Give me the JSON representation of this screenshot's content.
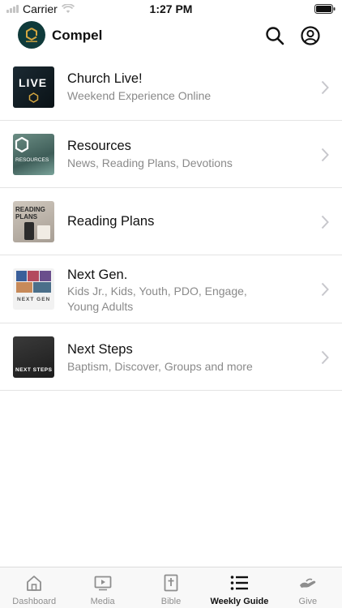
{
  "status": {
    "carrier": "Carrier",
    "time": "1:27 PM"
  },
  "header": {
    "title": "Compel"
  },
  "items": [
    {
      "title": "Church Live!",
      "subtitle": "Weekend Experience Online",
      "thumb_text": "LIVE"
    },
    {
      "title": "Resources",
      "subtitle": "News, Reading Plans, Devotions",
      "thumb_text": "RESOURCES"
    },
    {
      "title": "Reading Plans",
      "subtitle": "",
      "thumb_text": "READING PLANS"
    },
    {
      "title": "Next Gen.",
      "subtitle": "Kids Jr., Kids, Youth, PDO, Engage, Young Adults",
      "thumb_text": "NEXT GEN"
    },
    {
      "title": "Next Steps",
      "subtitle": "Baptism, Discover, Groups and more",
      "thumb_text": "NEXT STEPS"
    }
  ],
  "tabs": [
    {
      "label": "Dashboard",
      "icon": "home-icon"
    },
    {
      "label": "Media",
      "icon": "play-icon"
    },
    {
      "label": "Bible",
      "icon": "bible-icon"
    },
    {
      "label": "Weekly Guide",
      "icon": "list-icon",
      "active": true
    },
    {
      "label": "Give",
      "icon": "give-icon"
    }
  ],
  "colors": {
    "brand": "#0f3a3a",
    "accent_gold": "#d4a640",
    "muted_text": "#8a8a8a"
  }
}
